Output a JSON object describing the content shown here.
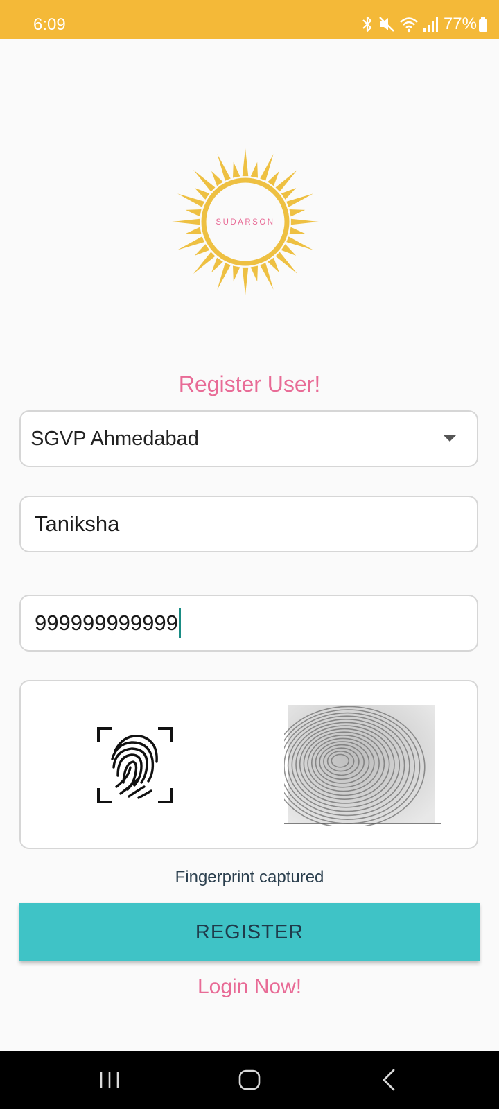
{
  "status_bar": {
    "time": "6:09",
    "battery": "77%",
    "background": "#f4b938",
    "icons": [
      "bluetooth-icon",
      "mute-icon",
      "wifi-icon",
      "signal-icon",
      "battery-icon"
    ]
  },
  "logo": {
    "text": "SUDARSON",
    "sun_color": "#eec042",
    "text_color": "#e86b96"
  },
  "form": {
    "title": "Register User!",
    "location_select": {
      "selected": "SGVP Ahmedabad"
    },
    "name_value": "Taniksha",
    "number_value": "999999999999",
    "fingerprint_icon": "fingerprint-scan-icon",
    "fingerprint_status": "Fingerprint captured",
    "register_label": "REGISTER",
    "login_link": "Login Now!"
  },
  "colors": {
    "accent_pink": "#e86b96",
    "button_teal": "#3fc3c6",
    "button_text": "#1f3a4a"
  },
  "nav_bar": {
    "icons": [
      "recent-apps-icon",
      "home-icon",
      "back-icon"
    ]
  }
}
